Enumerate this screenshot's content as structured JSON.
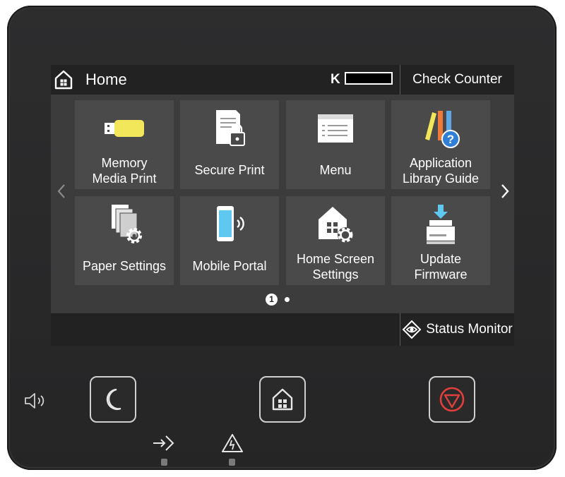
{
  "header": {
    "title": "Home",
    "toner_label": "K",
    "toner_level": 1.0,
    "check_counter": "Check Counter"
  },
  "tiles": [
    {
      "label": "Memory\nMedia Print",
      "icon": "usb-memory-icon"
    },
    {
      "label": "Secure Print",
      "icon": "secure-document-icon"
    },
    {
      "label": "Menu",
      "icon": "menu-list-icon"
    },
    {
      "label": "Application\nLibrary Guide",
      "icon": "application-library-guide-icon"
    },
    {
      "label": "Paper Settings",
      "icon": "paper-settings-icon"
    },
    {
      "label": "Mobile Portal",
      "icon": "mobile-portal-icon"
    },
    {
      "label": "Home Screen\nSettings",
      "icon": "home-screen-settings-icon"
    },
    {
      "label": "Update\nFirmware",
      "icon": "update-firmware-icon"
    }
  ],
  "pager": {
    "current": "1",
    "total_pages": 2
  },
  "footer": {
    "status_monitor": "Status Monitor"
  },
  "colors": {
    "screen_bg": "#3c3c3d",
    "tile_bg": "#4a4a4b",
    "bar_bg": "#222223",
    "usb_yellow": "#f2e65a",
    "stop_red": "#e0403a",
    "phone_blue": "#5fc8f0"
  }
}
